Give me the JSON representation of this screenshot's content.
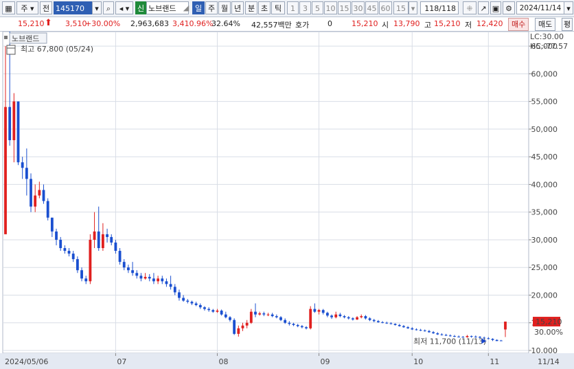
{
  "toolbar": {
    "mode_label": "주",
    "prev_label": "전",
    "code": "145170",
    "kind_badge": "신",
    "stock_name": "노브랜드",
    "period_tabs": [
      "일",
      "주",
      "월",
      "년",
      "분",
      "초",
      "틱"
    ],
    "active_period": "일",
    "interval_buttons": [
      "1",
      "3",
      "5",
      "10",
      "15",
      "30",
      "45",
      "60"
    ],
    "interval_value": "15",
    "count": "118/118",
    "date": "2024/11/14"
  },
  "quote": {
    "price": "15,210",
    "change": "3,510",
    "change_pct": "+30.00%",
    "volume": "2,963,683",
    "volume_pct": "3,410.96%",
    "turnover": "32.64%",
    "amount": "42,557백만",
    "hoga_label": "호가",
    "hoga_value": "0",
    "hoga_price": "15,210",
    "open_label": "시",
    "open": "13,790",
    "high_label": "고",
    "high": "15,210",
    "low_label": "저",
    "low": "12,420",
    "buy_label": "매수",
    "sell_label": "매도",
    "eval_label": "평"
  },
  "chart_data": {
    "type": "candlestick",
    "legend_name": "노브랜드",
    "annotations": {
      "max": "최고 67,800 (05/24)",
      "min": "최저 11,700 (11/13)",
      "lc": "LC:30.00",
      "hc": "HC:-77.57"
    },
    "ylim": [
      10000,
      67000
    ],
    "ticks_y": [
      "65,000",
      "60,000",
      "55,000",
      "50,000",
      "45,000",
      "40,000",
      "35,000",
      "30,000",
      "25,000",
      "20,000",
      "15,000",
      "10,000"
    ],
    "x_labels": [
      "2024/05/06",
      "07",
      "08",
      "09",
      "10",
      "11",
      "11/14"
    ],
    "last_price_label": "15,210",
    "last_pct_label": "30.00%",
    "candles": [
      [
        31000,
        54000,
        65000,
        31000
      ],
      [
        54000,
        48000,
        67800,
        47000
      ],
      [
        48000,
        55000,
        56500,
        44000
      ],
      [
        55000,
        44000,
        55000,
        43500
      ],
      [
        44000,
        43000,
        45000,
        41000
      ],
      [
        43000,
        41000,
        46500,
        38000
      ],
      [
        41000,
        36000,
        42000,
        35000
      ],
      [
        36000,
        38000,
        40000,
        35000
      ],
      [
        38000,
        39000,
        40500,
        37500
      ],
      [
        39000,
        37000,
        40000,
        36500
      ],
      [
        37000,
        34000,
        37500,
        33500
      ],
      [
        34000,
        31500,
        34000,
        30500
      ],
      [
        31500,
        30000,
        32000,
        29000
      ],
      [
        30000,
        28500,
        30500,
        28000
      ],
      [
        28500,
        28000,
        29000,
        27500
      ],
      [
        28000,
        27500,
        28500,
        27000
      ],
      [
        27500,
        26500,
        28000,
        26000
      ],
      [
        26500,
        24500,
        27000,
        24000
      ],
      [
        24500,
        23000,
        25000,
        22500
      ],
      [
        23000,
        22500,
        23500,
        22000
      ],
      [
        22500,
        30000,
        31000,
        22000
      ],
      [
        30000,
        31500,
        35000,
        28500
      ],
      [
        31500,
        28500,
        36000,
        28000
      ],
      [
        28500,
        31000,
        33000,
        28000
      ],
      [
        31000,
        30500,
        32000,
        29500
      ],
      [
        30500,
        29500,
        31000,
        29000
      ],
      [
        29500,
        28000,
        30000,
        27500
      ],
      [
        28000,
        26000,
        28500,
        25500
      ],
      [
        26000,
        25000,
        26500,
        24500
      ],
      [
        25000,
        24500,
        25500,
        24000
      ],
      [
        24500,
        24000,
        26000,
        23500
      ],
      [
        24000,
        23500,
        24500,
        23000
      ],
      [
        23500,
        23000,
        24000,
        22500
      ],
      [
        23000,
        23300,
        24000,
        22800
      ],
      [
        23300,
        23000,
        23800,
        22500
      ],
      [
        23000,
        22500,
        24000,
        22000
      ],
      [
        22500,
        23000,
        23500,
        22000
      ],
      [
        23000,
        22500,
        23500,
        22000
      ],
      [
        22500,
        22000,
        23000,
        21500
      ],
      [
        22000,
        21500,
        23500,
        21000
      ],
      [
        21500,
        20500,
        22000,
        20000
      ],
      [
        20500,
        19500,
        21000,
        19000
      ],
      [
        19500,
        19000,
        20000,
        18800
      ],
      [
        19000,
        18800,
        19300,
        18500
      ],
      [
        18800,
        18500,
        19000,
        18200
      ],
      [
        18500,
        18200,
        18800,
        18000
      ],
      [
        18200,
        17800,
        18500,
        17500
      ],
      [
        17800,
        17500,
        18000,
        17200
      ],
      [
        17500,
        17300,
        17800,
        17000
      ],
      [
        17300,
        17000,
        17500,
        16800
      ],
      [
        17000,
        17200,
        17500,
        16800
      ],
      [
        17200,
        16500,
        17400,
        16300
      ],
      [
        16500,
        16000,
        17000,
        15800
      ],
      [
        16000,
        15500,
        16200,
        15200
      ],
      [
        15500,
        13000,
        15800,
        12800
      ],
      [
        13000,
        14000,
        14500,
        12500
      ],
      [
        14000,
        14500,
        15000,
        13500
      ],
      [
        14500,
        15000,
        15500,
        14000
      ],
      [
        15000,
        17000,
        17500,
        14800
      ],
      [
        17000,
        16500,
        18500,
        16000
      ],
      [
        16500,
        16700,
        17000,
        16300
      ],
      [
        16700,
        16500,
        17000,
        16200
      ],
      [
        16500,
        16500,
        16800,
        16200
      ],
      [
        16500,
        16200,
        16800,
        16000
      ],
      [
        16200,
        16000,
        16500,
        15800
      ],
      [
        16000,
        15500,
        16200,
        15300
      ],
      [
        15500,
        15000,
        15800,
        14800
      ],
      [
        15000,
        14800,
        15300,
        14500
      ],
      [
        14800,
        14600,
        15000,
        14400
      ],
      [
        14600,
        14400,
        14800,
        14200
      ],
      [
        14400,
        14200,
        14600,
        14000
      ],
      [
        14200,
        14000,
        14400,
        13800
      ],
      [
        14000,
        17500,
        18000,
        13800
      ],
      [
        17500,
        17000,
        18500,
        16800
      ],
      [
        17000,
        17300,
        17500,
        16500
      ],
      [
        17300,
        16800,
        17500,
        16500
      ],
      [
        16800,
        16300,
        17000,
        16000
      ],
      [
        16300,
        16000,
        16500,
        15700
      ],
      [
        16000,
        16500,
        17000,
        15800
      ],
      [
        16500,
        16200,
        16800,
        16000
      ],
      [
        16200,
        16000,
        16400,
        15800
      ],
      [
        16000,
        15800,
        16200,
        15600
      ],
      [
        15800,
        15600,
        16000,
        15400
      ],
      [
        15600,
        16000,
        16200,
        15500
      ],
      [
        16000,
        16200,
        16500,
        15800
      ],
      [
        16200,
        15800,
        16400,
        15600
      ],
      [
        15800,
        15500,
        16000,
        15300
      ],
      [
        15500,
        15300,
        15700,
        15100
      ],
      [
        15300,
        15100,
        15500,
        15000
      ],
      [
        15100,
        15000,
        15300,
        14900
      ],
      [
        15000,
        14900,
        15200,
        14800
      ],
      [
        14900,
        14800,
        15100,
        14700
      ],
      [
        14800,
        14600,
        14900,
        14500
      ],
      [
        14600,
        14400,
        14800,
        14300
      ],
      [
        14400,
        14200,
        14600,
        14100
      ],
      [
        14200,
        14000,
        14400,
        13900
      ],
      [
        14000,
        13800,
        14200,
        13700
      ],
      [
        13800,
        13700,
        14000,
        13600
      ],
      [
        13700,
        13600,
        13900,
        13500
      ],
      [
        13600,
        13500,
        13800,
        13400
      ],
      [
        13500,
        13300,
        13700,
        13200
      ],
      [
        13300,
        13100,
        13500,
        13000
      ],
      [
        13100,
        12900,
        13300,
        12800
      ],
      [
        12900,
        12800,
        13100,
        12700
      ],
      [
        12800,
        12700,
        13000,
        12600
      ],
      [
        12700,
        12600,
        12900,
        12500
      ],
      [
        12600,
        12500,
        12800,
        12400
      ],
      [
        12500,
        12450,
        12700,
        12350
      ],
      [
        12450,
        12400,
        12600,
        12300
      ],
      [
        12400,
        12600,
        12800,
        12300
      ],
      [
        12600,
        12500,
        12700,
        12300
      ],
      [
        12500,
        12450,
        12700,
        12300
      ],
      [
        12450,
        12300,
        12600,
        12200
      ],
      [
        12300,
        12200,
        12500,
        12100
      ],
      [
        12200,
        12100,
        12400,
        12000
      ],
      [
        12100,
        11900,
        12200,
        11700
      ],
      [
        11900,
        11700,
        12000,
        11700
      ],
      [
        11800,
        11700,
        11900,
        11700
      ],
      [
        13790,
        15210,
        15210,
        12420
      ]
    ]
  }
}
